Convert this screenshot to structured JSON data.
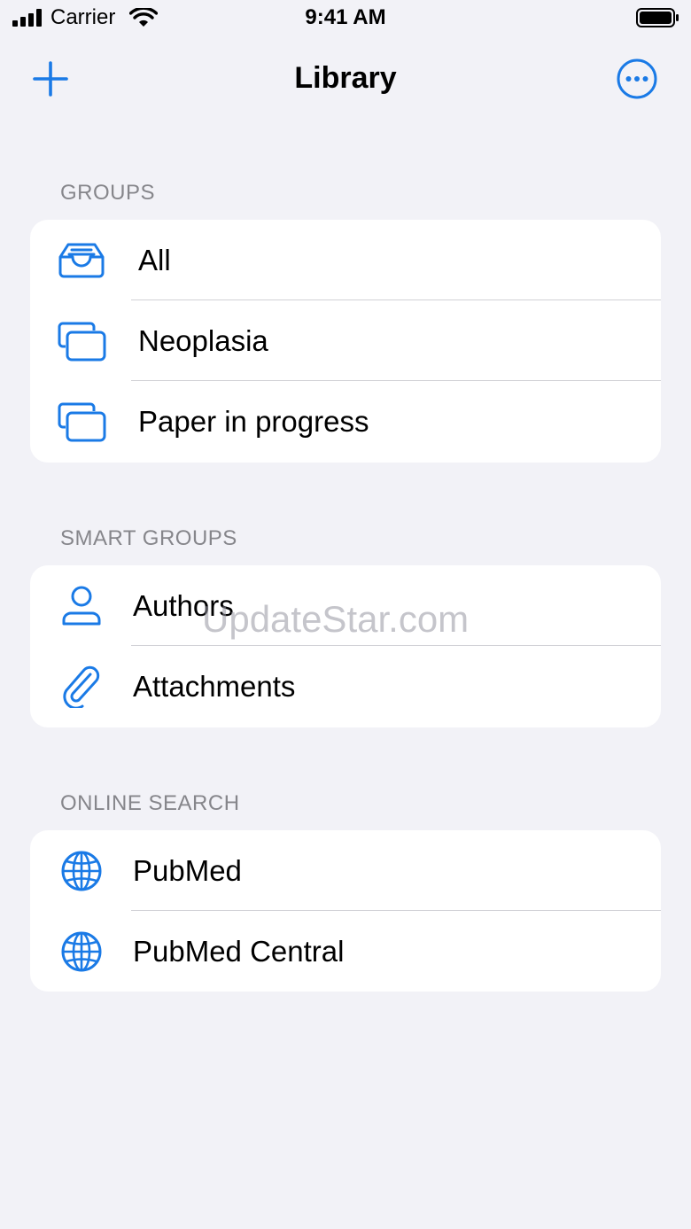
{
  "status_bar": {
    "carrier": "Carrier",
    "time": "9:41 AM"
  },
  "nav": {
    "title": "Library",
    "add_icon": "plus-icon",
    "more_icon": "ellipsis-circle-icon"
  },
  "colors": {
    "accent": "#1a7ae6",
    "background": "#f2f2f7",
    "section_header": "#86868b",
    "separator": "#d1d1d6"
  },
  "sections": {
    "groups": {
      "header": "GROUPS",
      "items": [
        {
          "label": "All",
          "icon": "tray-icon"
        },
        {
          "label": "Neoplasia",
          "icon": "folder-stack-icon"
        },
        {
          "label": "Paper in progress",
          "icon": "folder-stack-icon"
        }
      ]
    },
    "smart_groups": {
      "header": "SMART GROUPS",
      "items": [
        {
          "label": "Authors",
          "icon": "person-icon"
        },
        {
          "label": "Attachments",
          "icon": "paperclip-icon"
        }
      ]
    },
    "online_search": {
      "header": "ONLINE SEARCH",
      "items": [
        {
          "label": "PubMed",
          "icon": "globe-icon"
        },
        {
          "label": "PubMed Central",
          "icon": "globe-icon"
        }
      ]
    }
  },
  "watermark": "UpdateStar.com"
}
